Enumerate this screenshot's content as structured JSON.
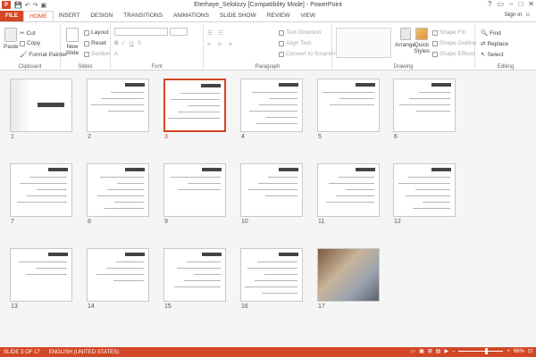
{
  "window": {
    "title": "Eterhaye_Selolozy [Compatibility Mode] - PowerPoint",
    "app_badge": "P",
    "controls": [
      "?",
      "▭",
      "–",
      "□",
      "✕"
    ]
  },
  "qat": [
    "💾",
    "↶",
    "↷",
    "▣"
  ],
  "tabs": [
    "FILE",
    "HOME",
    "INSERT",
    "DESIGN",
    "TRANSITIONS",
    "ANIMATIONS",
    "SLIDE SHOW",
    "REVIEW",
    "VIEW"
  ],
  "active_tab": "HOME",
  "signin": "Sign in",
  "ribbon": {
    "clipboard": {
      "label": "Clipboard",
      "paste": "Paste",
      "cut": "Cut",
      "copy": "Copy",
      "format_painter": "Format Painter"
    },
    "slides": {
      "label": "Slides",
      "new_slide": "New Slide",
      "layout": "Layout",
      "reset": "Reset",
      "section": "Section"
    },
    "font": {
      "label": "Font"
    },
    "paragraph": {
      "label": "Paragraph",
      "text_direction": "Text Direction",
      "align_text": "Align Text",
      "convert_smartart": "Convert to SmartArt"
    },
    "drawing": {
      "label": "Drawing",
      "arrange": "Arrange",
      "quick_styles": "Quick Styles",
      "shape_fill": "Shape Fill",
      "shape_outline": "Shape Outline",
      "shape_effects": "Shape Effects"
    },
    "editing": {
      "label": "Editing",
      "find": "Find",
      "replace": "Replace",
      "select": "Select"
    }
  },
  "slides": [
    {
      "num": "1"
    },
    {
      "num": "2"
    },
    {
      "num": "3"
    },
    {
      "num": "4"
    },
    {
      "num": "5"
    },
    {
      "num": "6"
    },
    {
      "num": "7"
    },
    {
      "num": "8"
    },
    {
      "num": "9"
    },
    {
      "num": "10"
    },
    {
      "num": "11"
    },
    {
      "num": "12"
    },
    {
      "num": "13"
    },
    {
      "num": "14"
    },
    {
      "num": "15"
    },
    {
      "num": "16"
    },
    {
      "num": "17"
    }
  ],
  "selected_slide": "3",
  "status": {
    "slide": "SLIDE 3 OF 17",
    "language": "ENGLISH (UNITED STATES)",
    "zoom": "66%"
  },
  "colors": {
    "accent": "#d24726",
    "workspace": "#f5f5f5"
  }
}
